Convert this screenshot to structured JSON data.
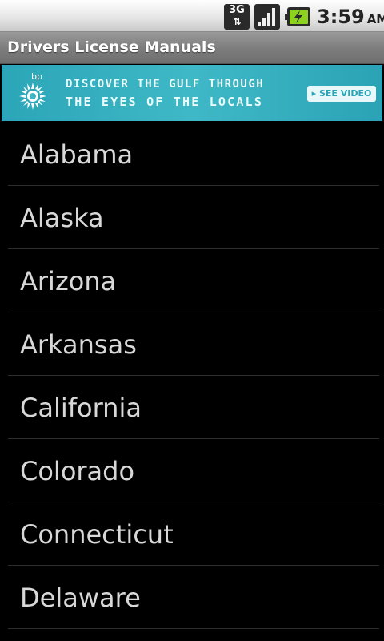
{
  "status_bar": {
    "network_type": "3G",
    "data_arrows": "⇅",
    "time": "3:59",
    "ampm": "AM",
    "icons": [
      "3g-data-icon",
      "signal-strength-icon",
      "battery-charging-icon"
    ]
  },
  "app": {
    "title": "Drivers License Manuals"
  },
  "ad": {
    "brand": "bp",
    "line1": "DISCOVER THE GULF THROUGH",
    "line2": "THE EYES OF THE LOCALS",
    "cta": "▸ SEE VIDEO",
    "colors": {
      "background": "#3fb8c6",
      "text": "#ffffff"
    }
  },
  "states": [
    {
      "label": "Alabama"
    },
    {
      "label": "Alaska"
    },
    {
      "label": "Arizona"
    },
    {
      "label": "Arkansas"
    },
    {
      "label": "California"
    },
    {
      "label": "Colorado"
    },
    {
      "label": "Connecticut"
    },
    {
      "label": "Delaware"
    }
  ],
  "colors": {
    "list_background": "#000000",
    "list_text": "#d8d8d8",
    "divider": "#2e2e2e"
  }
}
